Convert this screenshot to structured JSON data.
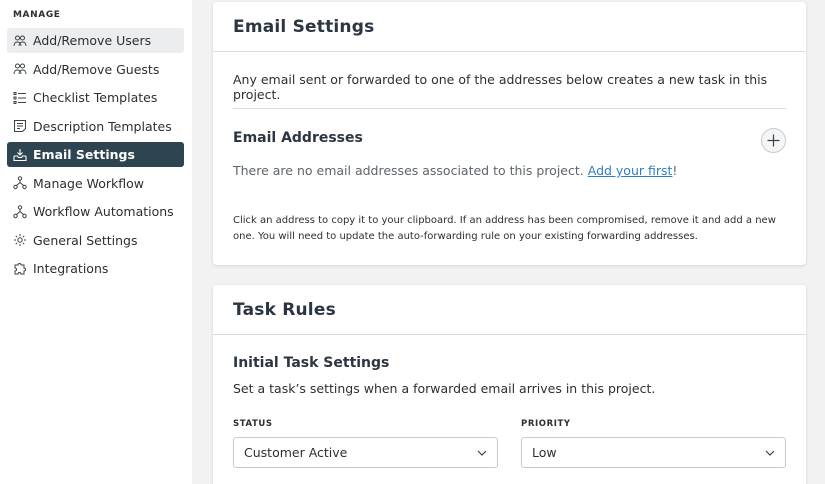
{
  "sidebar": {
    "section_label": "MANAGE",
    "items": [
      {
        "label": "Add/Remove Users",
        "icon": "users-icon"
      },
      {
        "label": "Add/Remove Guests",
        "icon": "guests-icon"
      },
      {
        "label": "Checklist Templates",
        "icon": "checklist-icon"
      },
      {
        "label": "Description Templates",
        "icon": "description-icon"
      },
      {
        "label": "Email Settings",
        "icon": "inbox-icon"
      },
      {
        "label": "Manage Workflow",
        "icon": "workflow-icon"
      },
      {
        "label": "Workflow Automations",
        "icon": "automation-icon"
      },
      {
        "label": "General Settings",
        "icon": "gear-icon"
      },
      {
        "label": "Integrations",
        "icon": "puzzle-icon"
      }
    ],
    "active_index": 4,
    "hover_index": 0
  },
  "email_settings": {
    "title": "Email Settings",
    "intro": "Any email sent or forwarded to one of the addresses below creates a new task in this project.",
    "addresses_heading": "Email Addresses",
    "empty_message": "There are no email addresses associated to this project.",
    "add_link": "Add your first",
    "add_link_suffix": "!",
    "help_text": "Click an address to copy it to your clipboard. If an address has been compromised, remove it and add a new one. You will need to update the auto-forwarding rule on your existing forwarding addresses."
  },
  "task_rules": {
    "title": "Task Rules",
    "subheading": "Initial Task Settings",
    "description": "Set a task’s settings when a forwarded email arrives in this project.",
    "status_label": "STATUS",
    "status_value": "Customer Active",
    "priority_label": "PRIORITY",
    "priority_value": "Low"
  },
  "colors": {
    "active_bg": "#2e4450",
    "link": "#2d7fc4",
    "page_bg": "#f2f2f2"
  }
}
